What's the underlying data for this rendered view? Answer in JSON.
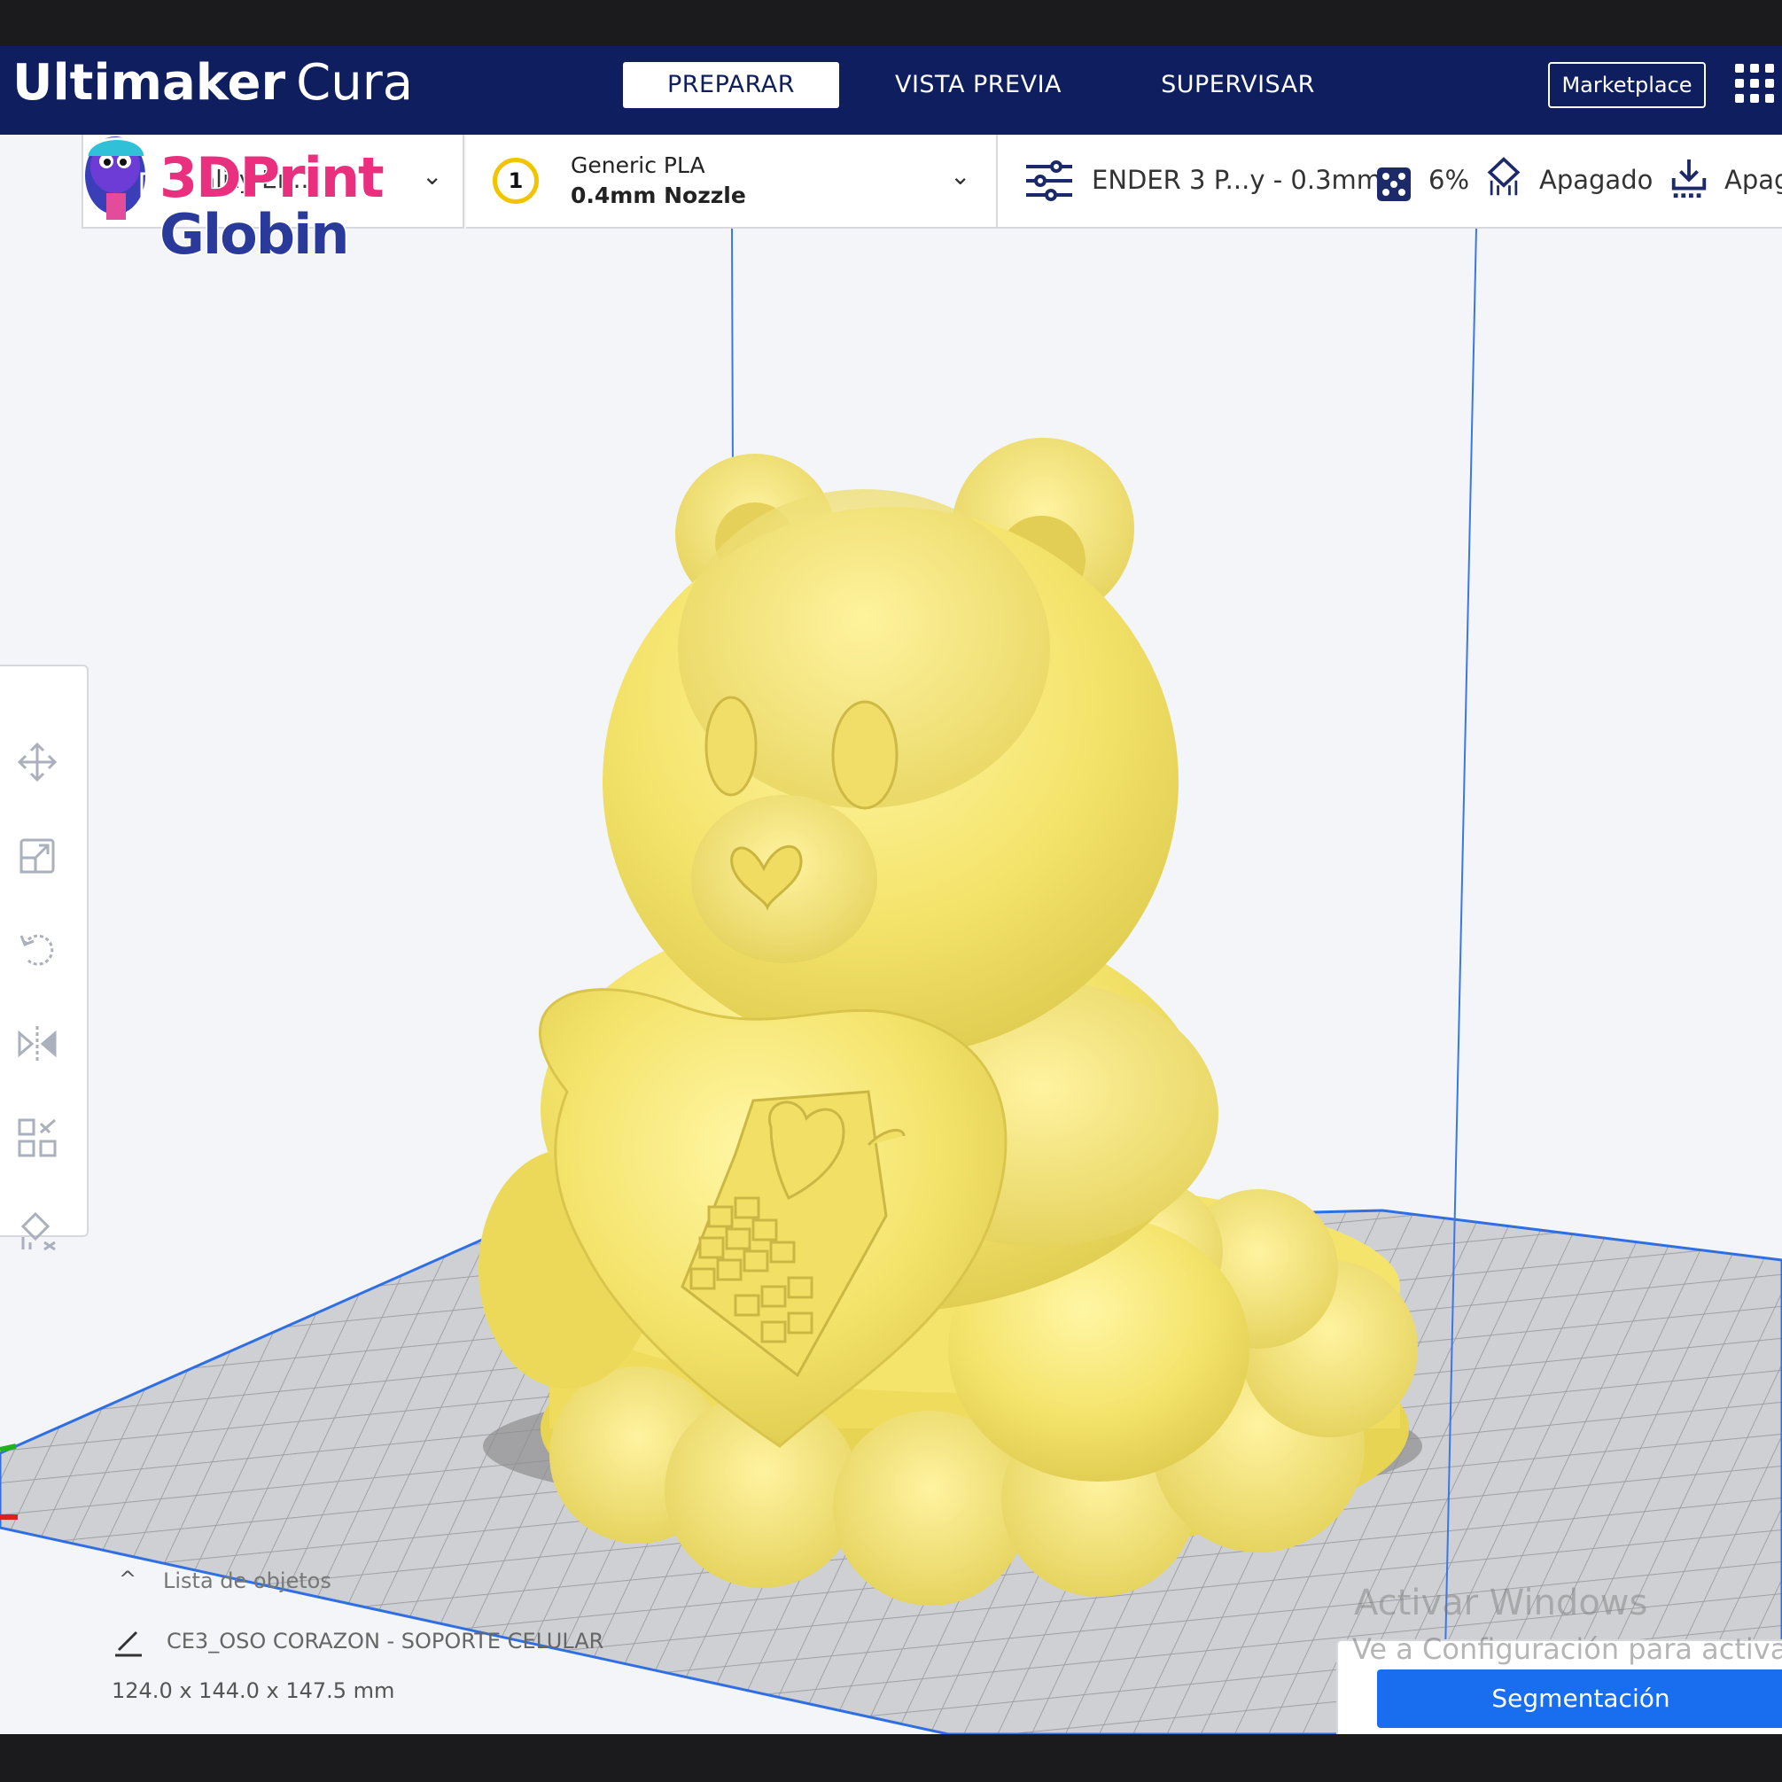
{
  "header": {
    "brand_bold": "Ultimaker",
    "brand_light": "Cura",
    "tabs": [
      {
        "label": "PREPARAR",
        "active": true
      },
      {
        "label": "VISTA PREVIA",
        "active": false
      },
      {
        "label": "SUPERVISAR",
        "active": false
      }
    ],
    "marketplace_label": "Marketplace",
    "accent_color": "#0f1e5e"
  },
  "logo": {
    "line1": "3DPrint",
    "line2": "Globin"
  },
  "printer": {
    "label": "ality En..."
  },
  "material": {
    "extruder_number": "1",
    "name": "Generic PLA",
    "nozzle": "0.4mm Nozzle",
    "extruder_color": "#f2c400"
  },
  "print_settings": {
    "profile": "ENDER 3 P...y - 0.3mm",
    "infill": "6%",
    "support": "Apagado",
    "adhesion": "Apag"
  },
  "object_list": {
    "header": "Lista de objetos",
    "object_name": "CE3_OSO CORAZON - SOPORTE CELULAR",
    "dimensions": "124.0 x 144.0 x 147.5 mm"
  },
  "watermark": {
    "line1": "Activar Windows",
    "line2": "Ve a Configuración para activar W"
  },
  "slice_button_label": "Segmentación",
  "model_color": "#f5e56b"
}
